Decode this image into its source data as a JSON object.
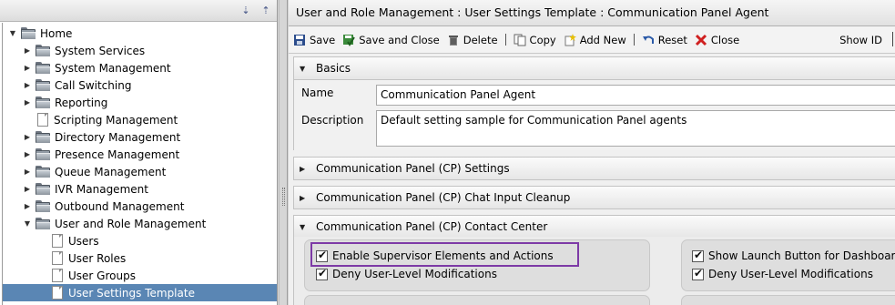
{
  "tree": {
    "toolbar": {
      "expand_all_icon": "⇣",
      "collapse_all_icon": "⇡"
    },
    "items": [
      {
        "label": "Home",
        "kind": "folder",
        "state": "expanded",
        "depth": 0
      },
      {
        "label": "System Services",
        "kind": "folder",
        "state": "collapsed",
        "depth": 1
      },
      {
        "label": "System Management",
        "kind": "folder",
        "state": "collapsed",
        "depth": 1
      },
      {
        "label": "Call Switching",
        "kind": "folder",
        "state": "collapsed",
        "depth": 1
      },
      {
        "label": "Reporting",
        "kind": "folder",
        "state": "collapsed",
        "depth": 1
      },
      {
        "label": "Scripting Management",
        "kind": "doc",
        "state": "leaf",
        "depth": 1
      },
      {
        "label": "Directory Management",
        "kind": "folder",
        "state": "collapsed",
        "depth": 1
      },
      {
        "label": "Presence Management",
        "kind": "folder",
        "state": "collapsed",
        "depth": 1
      },
      {
        "label": "Queue Management",
        "kind": "folder",
        "state": "collapsed",
        "depth": 1
      },
      {
        "label": "IVR Management",
        "kind": "folder",
        "state": "collapsed",
        "depth": 1
      },
      {
        "label": "Outbound Management",
        "kind": "folder",
        "state": "collapsed",
        "depth": 1
      },
      {
        "label": "User and Role Management",
        "kind": "folder",
        "state": "expanded",
        "depth": 1
      },
      {
        "label": "Users",
        "kind": "doc",
        "state": "leaf",
        "depth": 2
      },
      {
        "label": "User Roles",
        "kind": "doc",
        "state": "leaf",
        "depth": 2
      },
      {
        "label": "User Groups",
        "kind": "doc",
        "state": "leaf",
        "depth": 2
      },
      {
        "label": "User Settings Template",
        "kind": "doc",
        "state": "leaf",
        "depth": 2,
        "selected": true
      }
    ]
  },
  "panel": {
    "title": "User and Role Management : User Settings Template : Communication Panel Agent",
    "toolbar": {
      "save": "Save",
      "save_close": "Save and Close",
      "delete": "Delete",
      "copy": "Copy",
      "add_new": "Add New",
      "reset": "Reset",
      "close": "Close",
      "show_id": "Show ID"
    },
    "sections": {
      "basics": "Basics",
      "cp_settings": "Communication Panel (CP) Settings",
      "cp_chat_cleanup": "Communication Panel (CP) Chat Input Cleanup",
      "cp_contact_center": "Communication Panel (CP) Contact Center"
    },
    "basics": {
      "name_label": "Name",
      "name_value": "Communication Panel Agent",
      "description_label": "Description",
      "description_value": "Default setting sample for Communication Panel agents"
    },
    "contact_center": {
      "left": [
        {
          "label": "Enable Supervisor Elements and Actions",
          "checked": true
        },
        {
          "label": "Deny User-Level Modifications",
          "checked": true
        }
      ],
      "right": [
        {
          "label": "Show Launch Button for Dashboard",
          "checked": true
        },
        {
          "label": "Deny User-Level Modifications",
          "checked": true
        }
      ]
    }
  },
  "colors": {
    "selection": "#5a86b4",
    "highlight_border": "#7d3aa6",
    "delete_icon": "#d02020",
    "save_icon": "#2b4c8c"
  }
}
